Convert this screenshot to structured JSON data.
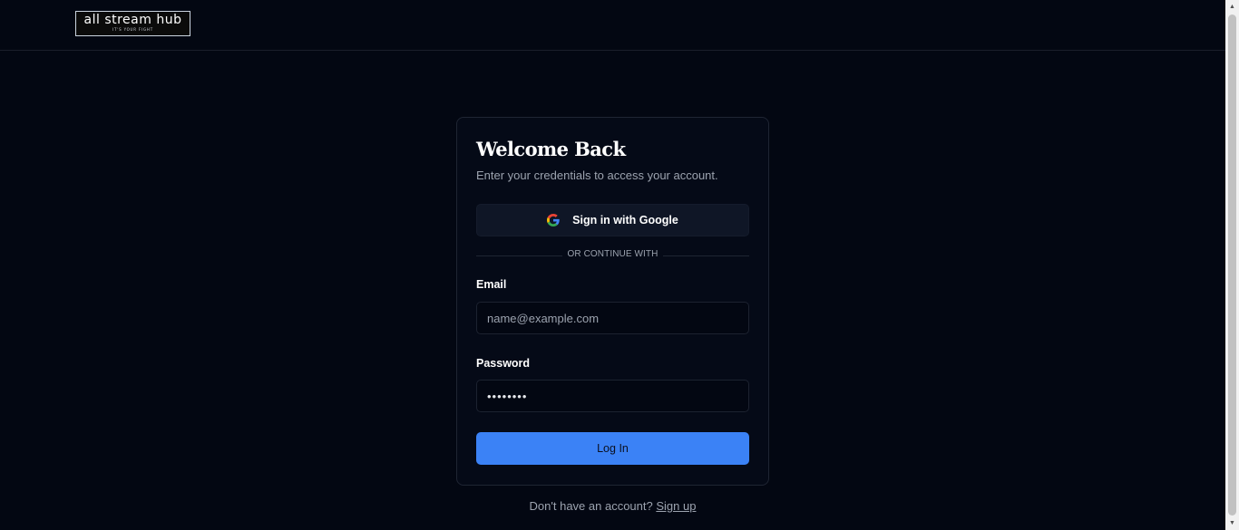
{
  "header": {
    "logo_title": "all stream hub",
    "logo_tagline": "IT'S YOUR FIGHT"
  },
  "login": {
    "title": "Welcome Back",
    "subtitle": "Enter your credentials to access your account.",
    "google_button_label": "Sign in with Google",
    "divider_text": "OR CONTINUE WITH",
    "email_label": "Email",
    "email_placeholder": "name@example.com",
    "email_value": "",
    "password_label": "Password",
    "password_value": "••••••••",
    "login_button_label": "Log In",
    "footer_prompt": "Don't have an account?",
    "signup_label": "Sign up"
  },
  "colors": {
    "background": "#030712",
    "card": "#050a17",
    "accent": "#3b82f6"
  },
  "icons": {
    "google": "google-icon"
  }
}
